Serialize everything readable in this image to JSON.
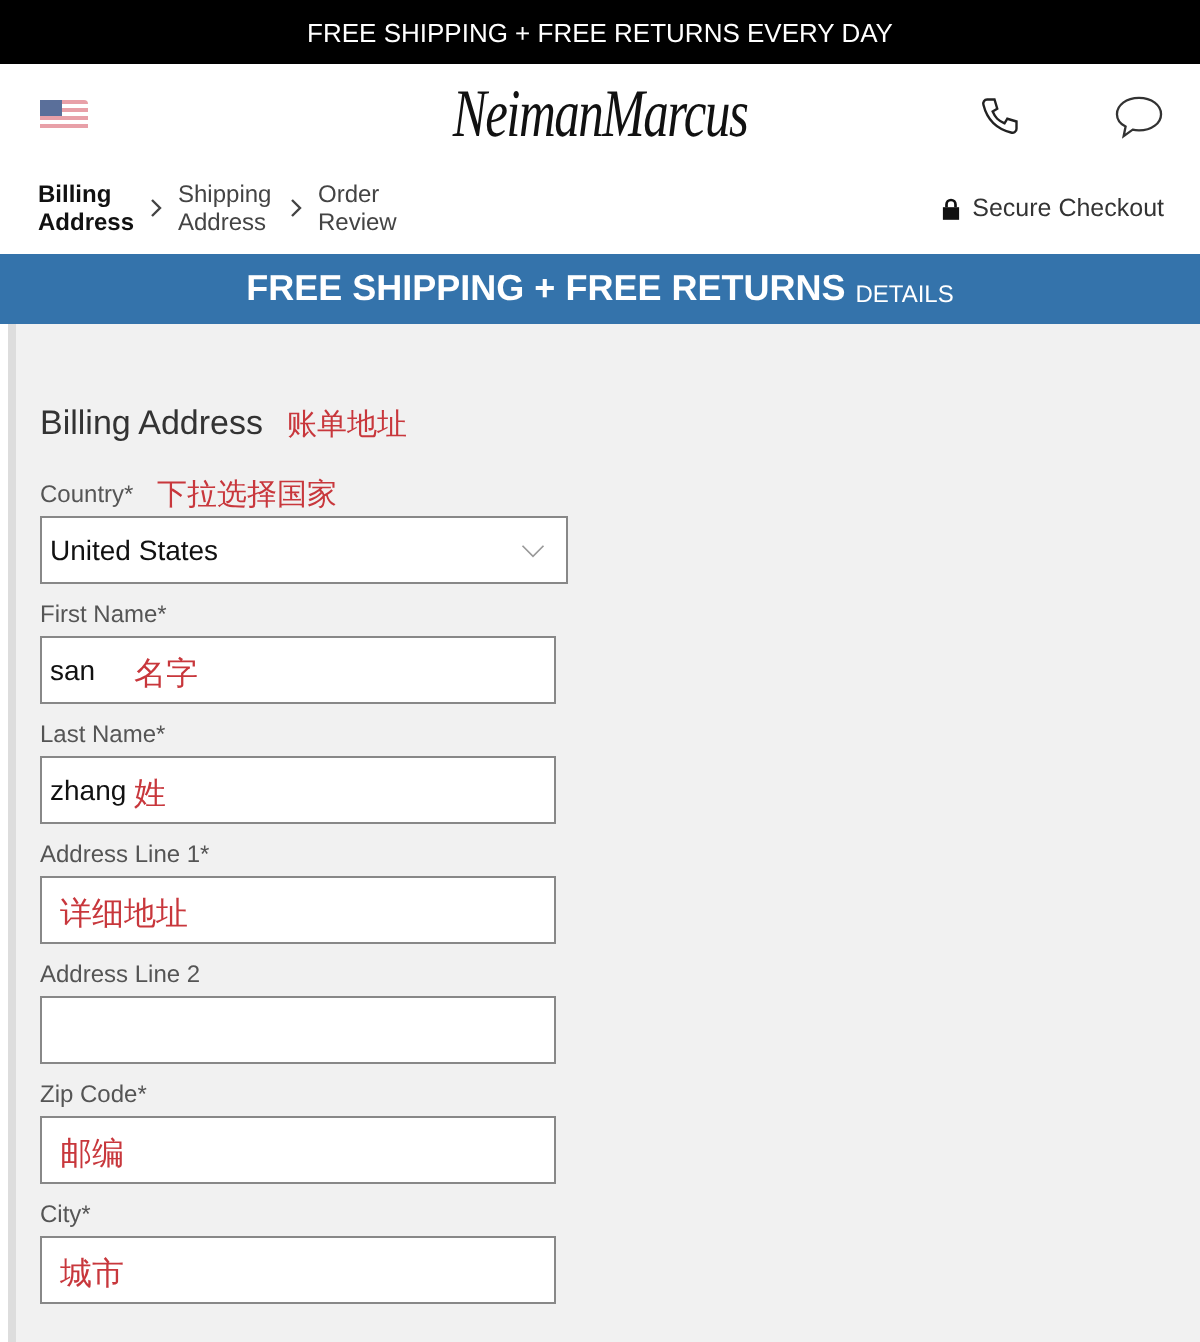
{
  "top_bar": {
    "text": "FREE SHIPPING + FREE RETURNS EVERY DAY"
  },
  "header": {
    "logo": "NeimanMarcus"
  },
  "steps": [
    {
      "label": "Billing Address",
      "selected": true
    },
    {
      "label": "Shipping Address",
      "selected": false
    },
    {
      "label": "Order Review",
      "selected": false
    }
  ],
  "secure": "Secure Checkout",
  "banner": {
    "text": "FREE SHIPPING + FREE RETURNS",
    "link": "DETAILS"
  },
  "form": {
    "title": "Billing Address",
    "note": "账单地址",
    "fields": [
      {
        "kind": "select",
        "label": "Country*",
        "value": "United States",
        "note": "下拉选择国家"
      },
      {
        "kind": "text",
        "label": "First Name*",
        "value": "san",
        "note": "名字"
      },
      {
        "kind": "text",
        "label": "Last Name*",
        "value": "zhang",
        "note": "姓"
      },
      {
        "kind": "text",
        "label": "Address Line 1*",
        "note": "详细地址"
      },
      {
        "kind": "text",
        "label": "Address Line 2"
      },
      {
        "kind": "text",
        "label": "Zip Code*",
        "note": "邮编"
      },
      {
        "kind": "text",
        "label": "City*",
        "note": "城市"
      }
    ]
  }
}
